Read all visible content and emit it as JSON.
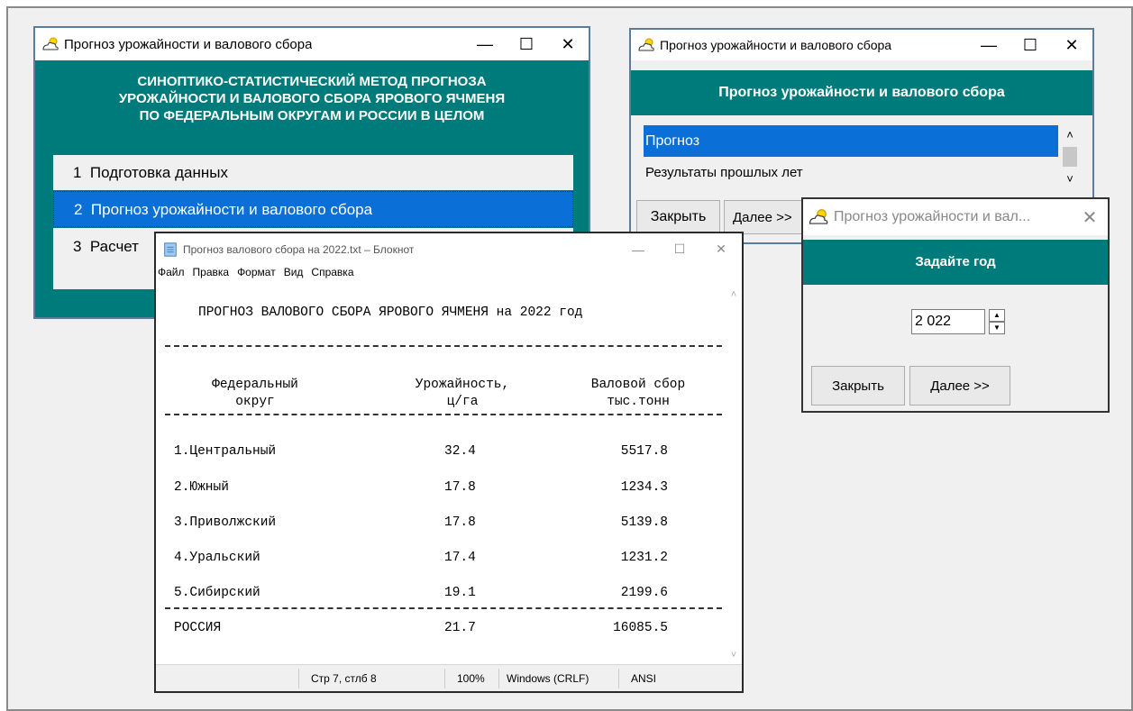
{
  "main_window": {
    "title": "Прогноз урожайности и валового сбора",
    "header_lines": [
      "СИНОПТИКО-СТАТИСТИЧЕСКИЙ МЕТОД ПРОГНОЗА",
      "УРОЖАЙНОСТИ И ВАЛОВОГО СБОРА ЯРОВОГО ЯЧМЕНЯ",
      "ПО ФЕДЕРАЛЬНЫМ ОКРУГАМ И РОССИИ В ЦЕЛОМ"
    ],
    "menu": [
      {
        "label": "1  Подготовка данных",
        "selected": false
      },
      {
        "label": "2  Прогноз урожайности и валового сбора",
        "selected": true
      },
      {
        "label": "3  Расчет",
        "selected": false
      }
    ]
  },
  "forecast_window": {
    "title": "Прогноз урожайности и валового сбора",
    "header": "Прогноз урожайности и валового сбора",
    "list": [
      {
        "label": "Прогноз",
        "selected": true
      },
      {
        "label": "Результаты прошлых лет",
        "selected": false
      }
    ],
    "close_label": "Закрыть",
    "next_label": "Далее >>"
  },
  "year_window": {
    "title": "Прогноз урожайности и вал...",
    "header": "Задайте год",
    "year_value": "2 022",
    "close_label": "Закрыть",
    "next_label": "Далее >>"
  },
  "notepad": {
    "title": "Прогноз валового сбора на 2022.txt – Блокнот",
    "menu": [
      "Файл",
      "Правка",
      "Формат",
      "Вид",
      "Справка"
    ],
    "report_title": "ПРОГНОЗ ВАЛОВОГО СБОРА ЯРОВОГО ЯЧМЕНЯ на 2022 год",
    "col_headers": {
      "district": [
        "Федеральный",
        "округ"
      ],
      "yield": [
        "Урожайность,",
        "ц/га"
      ],
      "harvest": [
        "Валовой сбор",
        "тыс.тонн"
      ]
    },
    "rows": [
      {
        "name": "1.Центральный",
        "yield": "32.4",
        "harvest": "5517.8"
      },
      {
        "name": "2.Южный",
        "yield": "17.8",
        "harvest": "1234.3"
      },
      {
        "name": "3.Приволжский",
        "yield": "17.8",
        "harvest": "5139.8"
      },
      {
        "name": "4.Уральский",
        "yield": "17.4",
        "harvest": "1231.2"
      },
      {
        "name": "5.Сибирский",
        "yield": "19.1",
        "harvest": "2199.6"
      }
    ],
    "total": {
      "name": "РОССИЯ",
      "yield": "21.7",
      "harvest": "16085.5"
    },
    "status": {
      "position": "Стр 7, стлб 8",
      "zoom": "100%",
      "line_endings": "Windows (CRLF)",
      "encoding": "ANSI"
    }
  }
}
